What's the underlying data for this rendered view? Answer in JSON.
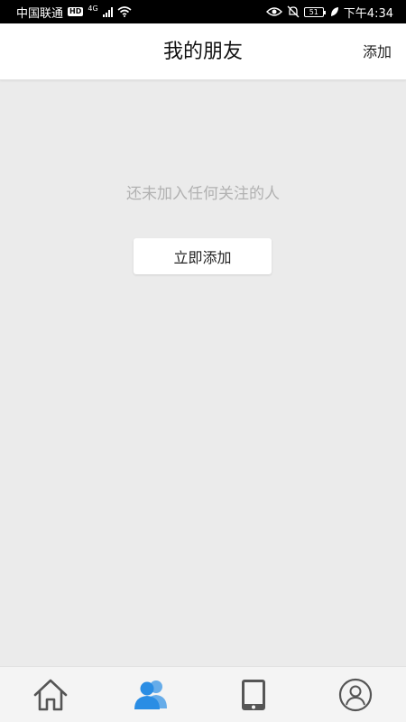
{
  "status_bar": {
    "carrier": "中国联通",
    "hd": "HD",
    "network": "4G",
    "battery": "51",
    "time": "下午4:34"
  },
  "header": {
    "title": "我的朋友",
    "add_label": "添加"
  },
  "empty_state": {
    "message": "还未加入任何关注的人",
    "button_label": "立即添加"
  },
  "tab_bar": {
    "tabs": [
      {
        "icon": "home-icon",
        "active": false
      },
      {
        "icon": "friends-icon",
        "active": true
      },
      {
        "icon": "device-icon",
        "active": false
      },
      {
        "icon": "profile-icon",
        "active": false
      }
    ],
    "active_color": "#2a8de4",
    "inactive_color": "#555555"
  }
}
